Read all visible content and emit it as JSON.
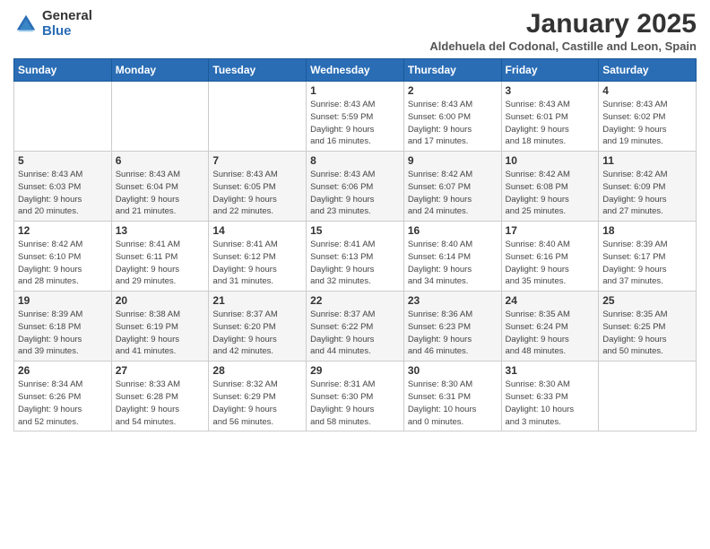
{
  "header": {
    "logo_general": "General",
    "logo_blue": "Blue",
    "month_title": "January 2025",
    "subtitle": "Aldehuela del Codonal, Castille and Leon, Spain"
  },
  "weekdays": [
    "Sunday",
    "Monday",
    "Tuesday",
    "Wednesday",
    "Thursday",
    "Friday",
    "Saturday"
  ],
  "weeks": [
    [
      {
        "day": "",
        "info": ""
      },
      {
        "day": "",
        "info": ""
      },
      {
        "day": "",
        "info": ""
      },
      {
        "day": "1",
        "info": "Sunrise: 8:43 AM\nSunset: 5:59 PM\nDaylight: 9 hours\nand 16 minutes."
      },
      {
        "day": "2",
        "info": "Sunrise: 8:43 AM\nSunset: 6:00 PM\nDaylight: 9 hours\nand 17 minutes."
      },
      {
        "day": "3",
        "info": "Sunrise: 8:43 AM\nSunset: 6:01 PM\nDaylight: 9 hours\nand 18 minutes."
      },
      {
        "day": "4",
        "info": "Sunrise: 8:43 AM\nSunset: 6:02 PM\nDaylight: 9 hours\nand 19 minutes."
      }
    ],
    [
      {
        "day": "5",
        "info": "Sunrise: 8:43 AM\nSunset: 6:03 PM\nDaylight: 9 hours\nand 20 minutes."
      },
      {
        "day": "6",
        "info": "Sunrise: 8:43 AM\nSunset: 6:04 PM\nDaylight: 9 hours\nand 21 minutes."
      },
      {
        "day": "7",
        "info": "Sunrise: 8:43 AM\nSunset: 6:05 PM\nDaylight: 9 hours\nand 22 minutes."
      },
      {
        "day": "8",
        "info": "Sunrise: 8:43 AM\nSunset: 6:06 PM\nDaylight: 9 hours\nand 23 minutes."
      },
      {
        "day": "9",
        "info": "Sunrise: 8:42 AM\nSunset: 6:07 PM\nDaylight: 9 hours\nand 24 minutes."
      },
      {
        "day": "10",
        "info": "Sunrise: 8:42 AM\nSunset: 6:08 PM\nDaylight: 9 hours\nand 25 minutes."
      },
      {
        "day": "11",
        "info": "Sunrise: 8:42 AM\nSunset: 6:09 PM\nDaylight: 9 hours\nand 27 minutes."
      }
    ],
    [
      {
        "day": "12",
        "info": "Sunrise: 8:42 AM\nSunset: 6:10 PM\nDaylight: 9 hours\nand 28 minutes."
      },
      {
        "day": "13",
        "info": "Sunrise: 8:41 AM\nSunset: 6:11 PM\nDaylight: 9 hours\nand 29 minutes."
      },
      {
        "day": "14",
        "info": "Sunrise: 8:41 AM\nSunset: 6:12 PM\nDaylight: 9 hours\nand 31 minutes."
      },
      {
        "day": "15",
        "info": "Sunrise: 8:41 AM\nSunset: 6:13 PM\nDaylight: 9 hours\nand 32 minutes."
      },
      {
        "day": "16",
        "info": "Sunrise: 8:40 AM\nSunset: 6:14 PM\nDaylight: 9 hours\nand 34 minutes."
      },
      {
        "day": "17",
        "info": "Sunrise: 8:40 AM\nSunset: 6:16 PM\nDaylight: 9 hours\nand 35 minutes."
      },
      {
        "day": "18",
        "info": "Sunrise: 8:39 AM\nSunset: 6:17 PM\nDaylight: 9 hours\nand 37 minutes."
      }
    ],
    [
      {
        "day": "19",
        "info": "Sunrise: 8:39 AM\nSunset: 6:18 PM\nDaylight: 9 hours\nand 39 minutes."
      },
      {
        "day": "20",
        "info": "Sunrise: 8:38 AM\nSunset: 6:19 PM\nDaylight: 9 hours\nand 41 minutes."
      },
      {
        "day": "21",
        "info": "Sunrise: 8:37 AM\nSunset: 6:20 PM\nDaylight: 9 hours\nand 42 minutes."
      },
      {
        "day": "22",
        "info": "Sunrise: 8:37 AM\nSunset: 6:22 PM\nDaylight: 9 hours\nand 44 minutes."
      },
      {
        "day": "23",
        "info": "Sunrise: 8:36 AM\nSunset: 6:23 PM\nDaylight: 9 hours\nand 46 minutes."
      },
      {
        "day": "24",
        "info": "Sunrise: 8:35 AM\nSunset: 6:24 PM\nDaylight: 9 hours\nand 48 minutes."
      },
      {
        "day": "25",
        "info": "Sunrise: 8:35 AM\nSunset: 6:25 PM\nDaylight: 9 hours\nand 50 minutes."
      }
    ],
    [
      {
        "day": "26",
        "info": "Sunrise: 8:34 AM\nSunset: 6:26 PM\nDaylight: 9 hours\nand 52 minutes."
      },
      {
        "day": "27",
        "info": "Sunrise: 8:33 AM\nSunset: 6:28 PM\nDaylight: 9 hours\nand 54 minutes."
      },
      {
        "day": "28",
        "info": "Sunrise: 8:32 AM\nSunset: 6:29 PM\nDaylight: 9 hours\nand 56 minutes."
      },
      {
        "day": "29",
        "info": "Sunrise: 8:31 AM\nSunset: 6:30 PM\nDaylight: 9 hours\nand 58 minutes."
      },
      {
        "day": "30",
        "info": "Sunrise: 8:30 AM\nSunset: 6:31 PM\nDaylight: 10 hours\nand 0 minutes."
      },
      {
        "day": "31",
        "info": "Sunrise: 8:30 AM\nSunset: 6:33 PM\nDaylight: 10 hours\nand 3 minutes."
      },
      {
        "day": "",
        "info": ""
      }
    ]
  ]
}
